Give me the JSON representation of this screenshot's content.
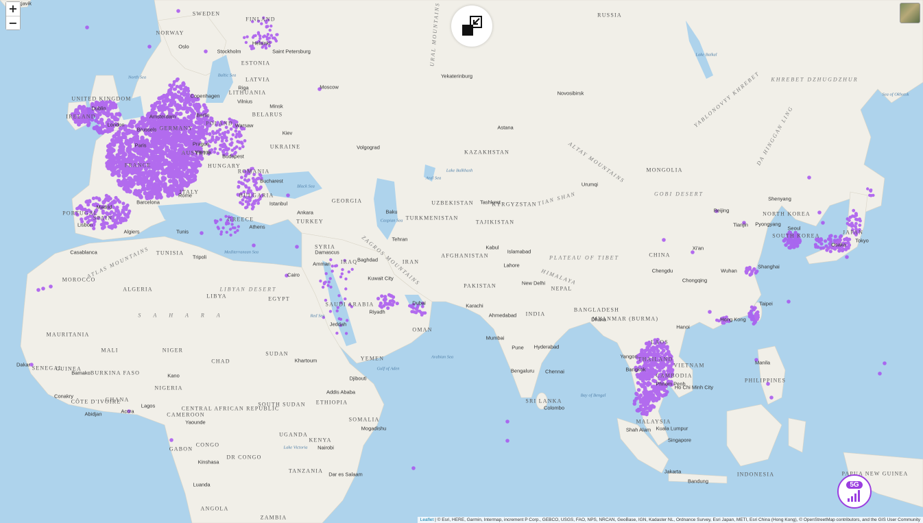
{
  "zoom": {
    "in_label": "+",
    "out_label": "−"
  },
  "attribution": {
    "link": "Leaflet",
    "text": " | © Esri, HERE, Garmin, Intermap, increment P Corp., GEBCO, USGS, FAO, NPS, NRCAN, GeoBase, IGN, Kadaster NL, Ordnance Survey, Esri Japan, METI, Esri China (Hong Kong), © OpenStreetMap contributors, and the GIS User Community"
  },
  "badge": {
    "label": "5G"
  },
  "colors": {
    "coverage": "#a855f0",
    "ocean": "#aed3ec",
    "land": "#f2f0ea",
    "accent": "#9b3fe0"
  },
  "labels": {
    "countries": [
      "SWEDEN",
      "FINLAND",
      "NORWAY",
      "ESTONIA",
      "LATVIA",
      "LITHUANIA",
      "BELARUS",
      "UKRAINE",
      "UNITED KINGDOM",
      "IRELAND",
      "GERMANY",
      "POLAND",
      "FRANCE",
      "AUSTRIA",
      "HUNGARY",
      "ROMANIA",
      "BULGARIA",
      "PORTUGAL",
      "SPAIN",
      "ITALY",
      "GREECE",
      "TURKEY",
      "GEORGIA",
      "RUSSIA",
      "KAZAKHSTAN",
      "UZBEKISTAN",
      "KYRGYZSTAN",
      "TAJIKISTAN",
      "TURKMENISTAN",
      "AFGHANISTAN",
      "PAKISTAN",
      "IRAN",
      "IRAQ",
      "SYRIA",
      "SAUDI ARABIA",
      "YEMEN",
      "OMAN",
      "EGYPT",
      "LIBYA",
      "ALGERIA",
      "TUNISIA",
      "MOROCCO",
      "MAURITANIA",
      "MALI",
      "NIGER",
      "CHAD",
      "SUDAN",
      "SOUTH SUDAN",
      "ETHIOPIA",
      "SOMALIA",
      "KENYA",
      "UGANDA",
      "TANZANIA",
      "DR CONGO",
      "CONGO",
      "GABON",
      "CAMEROON",
      "CENTRAL AFRICAN REPUBLIC",
      "NIGERIA",
      "GHANA",
      "CÔTE D'IVOIRE",
      "GUINEA",
      "SENEGAL",
      "BURKINA FASO",
      "ANGOLA",
      "ZAMBIA",
      "INDIA",
      "NEPAL",
      "BANGLADESH",
      "MYANMAR (BURMA)",
      "THAILAND",
      "LAOS",
      "VIETNAM",
      "CAMBODIA",
      "MALAYSIA",
      "INDONESIA",
      "PHILIPPINES",
      "CHINA",
      "MONGOLIA",
      "NORTH KOREA",
      "SOUTH KOREA",
      "JAPAN",
      "SRI LANKA",
      "PAPUA NEW GUINEA"
    ],
    "physical": [
      "URAL MOUNTAINS",
      "ALTAY MOUNTAINS",
      "ZAGROS MOUNTAINS",
      "ATLAS MOUNTAINS",
      "GOBI DESERT",
      "LIBYAN DESERT",
      "SAHARA",
      "PLATEAU OF TIBET",
      "HIMALAYA",
      "TIAN SHAN",
      "KHREBET DZHUGDZHUR",
      "YABLONOVYY KHREBET",
      "DA HINGGAN LING"
    ],
    "seas": [
      "North Sea",
      "Baltic Sea",
      "Black Sea",
      "Caspian Sea",
      "Mediterranean Sea",
      "Red Sea",
      "Arabian Sea",
      "Bay of Bengal",
      "Sea of Okhotsk",
      "Aral Sea",
      "Lake Baikal",
      "Lake Balkhash",
      "Lake Victoria",
      "Gulf of Aden"
    ],
    "cities": [
      "Reykjavik",
      "Oslo",
      "Stockholm",
      "Helsinki",
      "Saint Petersburg",
      "Moscow",
      "Copenhagen",
      "Vilnius",
      "Minsk",
      "Riga",
      "Dublin",
      "London",
      "Amsterdam",
      "Brussels",
      "Paris",
      "Berlin",
      "Warsaw",
      "Prague",
      "Vienna",
      "Budapest",
      "Kiev",
      "Bucharest",
      "Istanbul",
      "Athens",
      "Madrid",
      "Lisbon",
      "Barcelona",
      "Rome",
      "Algiers",
      "Tunis",
      "Tripoli",
      "Casablanca",
      "Cairo",
      "Amman",
      "Damascus",
      "Baghdad",
      "Kuwait City",
      "Riyadh",
      "Jeddah",
      "Dubai",
      "Tehran",
      "Baku",
      "Ankara",
      "Volgograd",
      "Yekaterinburg",
      "Novosibirsk",
      "Astana",
      "Urumqi",
      "Tashkent",
      "Kabul",
      "Islamabad",
      "Lahore",
      "Karachi",
      "New Delhi",
      "Ahmedabad",
      "Mumbai",
      "Pune",
      "Hyderabad",
      "Bengaluru",
      "Chennai",
      "Colombo",
      "Dhaka",
      "Yangon",
      "Bangkok",
      "Hanoi",
      "Phnom Penh",
      "Ho Chi Minh City",
      "Kuala Lumpur",
      "Shah Alam",
      "Singapore",
      "Jakarta",
      "Bandung",
      "Manila",
      "Hong Kong",
      "Taipei",
      "Shanghai",
      "Wuhan",
      "Chengdu",
      "Chongqing",
      "Xi'an",
      "Beijing",
      "Tianjin",
      "Shenyang",
      "Pyongyang",
      "Seoul",
      "Osaka",
      "Tokyo",
      "Khartoum",
      "Djibouti",
      "Addis Ababa",
      "Mogadishu",
      "Nairobi",
      "Dar es Salaam",
      "Kinshasa",
      "Luanda",
      "Lagos",
      "Abidjan",
      "Accra",
      "Bamako",
      "Conakry",
      "Dakar",
      "Kano",
      "Yaounde"
    ]
  }
}
